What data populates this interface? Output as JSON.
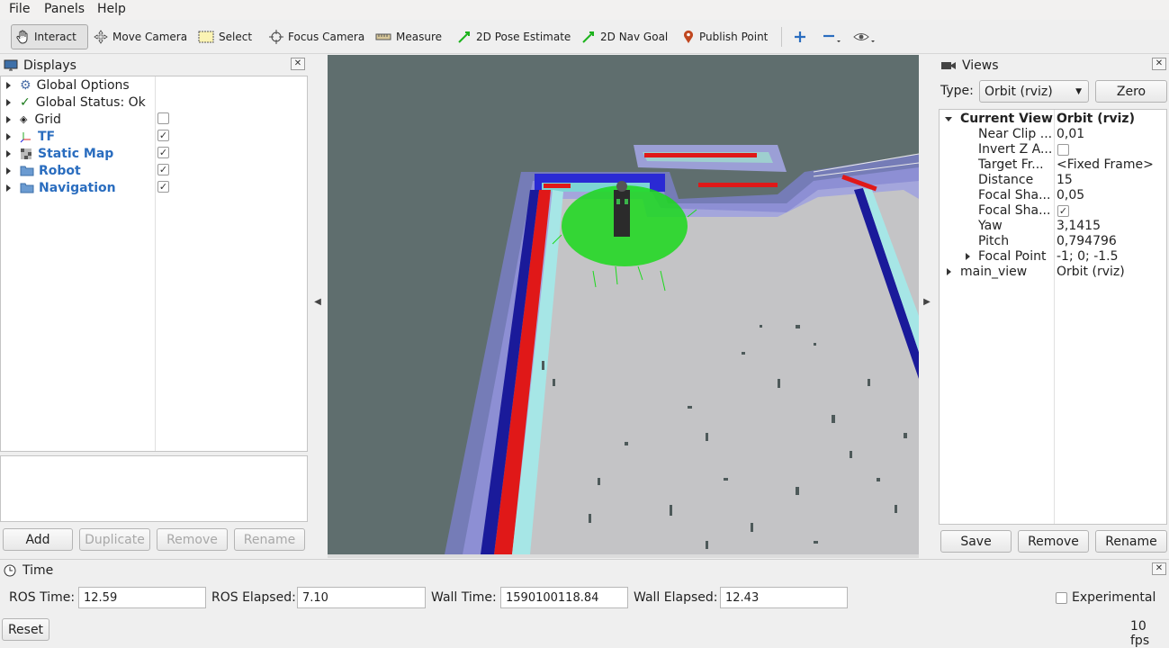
{
  "menu": {
    "file": "File",
    "panels": "Panels",
    "help": "Help"
  },
  "toolbar": {
    "interact": "Interact",
    "move_camera": "Move Camera",
    "select": "Select",
    "focus_camera": "Focus Camera",
    "measure": "Measure",
    "pose_estimate": "2D Pose Estimate",
    "nav_goal": "2D Nav Goal",
    "publish_point": "Publish Point"
  },
  "displays": {
    "title": "Displays",
    "items": [
      {
        "label": "Global Options",
        "icon": "gear-icon"
      },
      {
        "label": "Global Status: Ok",
        "icon": "check-icon"
      },
      {
        "label": "Grid",
        "icon": "grid-icon",
        "checked": false
      },
      {
        "label": "TF",
        "icon": "axes-icon",
        "checked": true
      },
      {
        "label": "Static Map",
        "icon": "map-icon",
        "checked": true
      },
      {
        "label": "Robot",
        "icon": "folder-icon",
        "checked": true
      },
      {
        "label": "Navigation",
        "icon": "folder-icon",
        "checked": true
      }
    ],
    "buttons": {
      "add": "Add",
      "duplicate": "Duplicate",
      "remove": "Remove",
      "rename": "Rename"
    }
  },
  "views": {
    "title": "Views",
    "type_label": "Type:",
    "type_value": "Orbit (rviz)",
    "zero": "Zero",
    "current_view": {
      "key": "Current View",
      "value": "Orbit (rviz)"
    },
    "props": [
      {
        "key": "Near Clip ...",
        "value": "0,01"
      },
      {
        "key": "Invert Z A...",
        "value": ""
      },
      {
        "key": "Target Fr...",
        "value": "<Fixed Frame>"
      },
      {
        "key": "Distance",
        "value": "15"
      },
      {
        "key": "Focal Sha...",
        "value": "0,05"
      },
      {
        "key": "Focal Sha...",
        "value": ""
      },
      {
        "key": "Yaw",
        "value": "3,1415"
      },
      {
        "key": "Pitch",
        "value": "0,794796"
      },
      {
        "key": "Focal Point",
        "value": "-1; 0; -1.5"
      }
    ],
    "main_view": {
      "key": "main_view",
      "value": "Orbit (rviz)"
    },
    "buttons": {
      "save": "Save",
      "remove": "Remove",
      "rename": "Rename"
    }
  },
  "time": {
    "title": "Time",
    "ros_time_label": "ROS Time:",
    "ros_time": "12.59",
    "ros_elapsed_label": "ROS Elapsed:",
    "ros_elapsed": "7.10",
    "wall_time_label": "Wall Time:",
    "wall_time": "1590100118.84",
    "wall_elapsed_label": "Wall Elapsed:",
    "wall_elapsed": "12.43",
    "experimental": "Experimental",
    "reset": "Reset",
    "fps": "10 fps"
  }
}
